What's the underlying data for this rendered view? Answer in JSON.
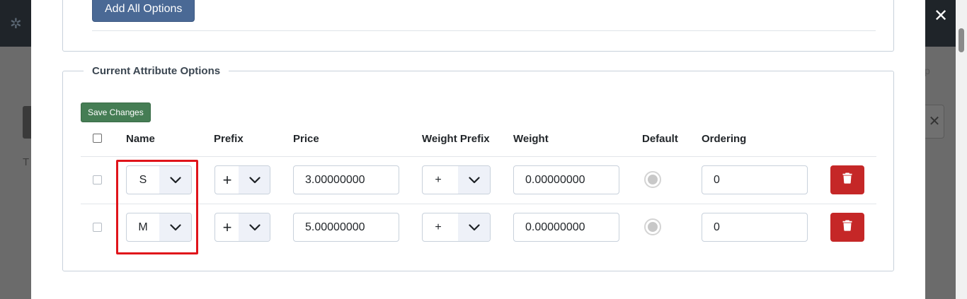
{
  "modal": {
    "close_icon": "✕",
    "add_all_label": "Add All Options",
    "legend": "Current Attribute Options",
    "save_label": "Save Changes"
  },
  "table": {
    "headers": [
      "Name",
      "Prefix",
      "Price",
      "Weight Prefix",
      "Weight",
      "Default",
      "Ordering"
    ],
    "rows": [
      {
        "name": "S",
        "prefix": "+",
        "price": "3.00000000",
        "weight_prefix": "+",
        "weight": "0.00000000",
        "default": false,
        "ordering": "0"
      },
      {
        "name": "M",
        "prefix": "+",
        "price": "5.00000000",
        "weight_prefix": "+",
        "weight": "0.00000000",
        "default": false,
        "ordering": "0"
      }
    ]
  },
  "colors": {
    "add_all_button": "#4a6995",
    "save_button": "#457d54",
    "delete_button": "#c52727",
    "highlight": "#e0141b"
  },
  "icons": {
    "logo": "joomla-logo-icon",
    "close": "close-icon",
    "dropdown": "chevron-down-icon",
    "delete": "trash-icon"
  }
}
